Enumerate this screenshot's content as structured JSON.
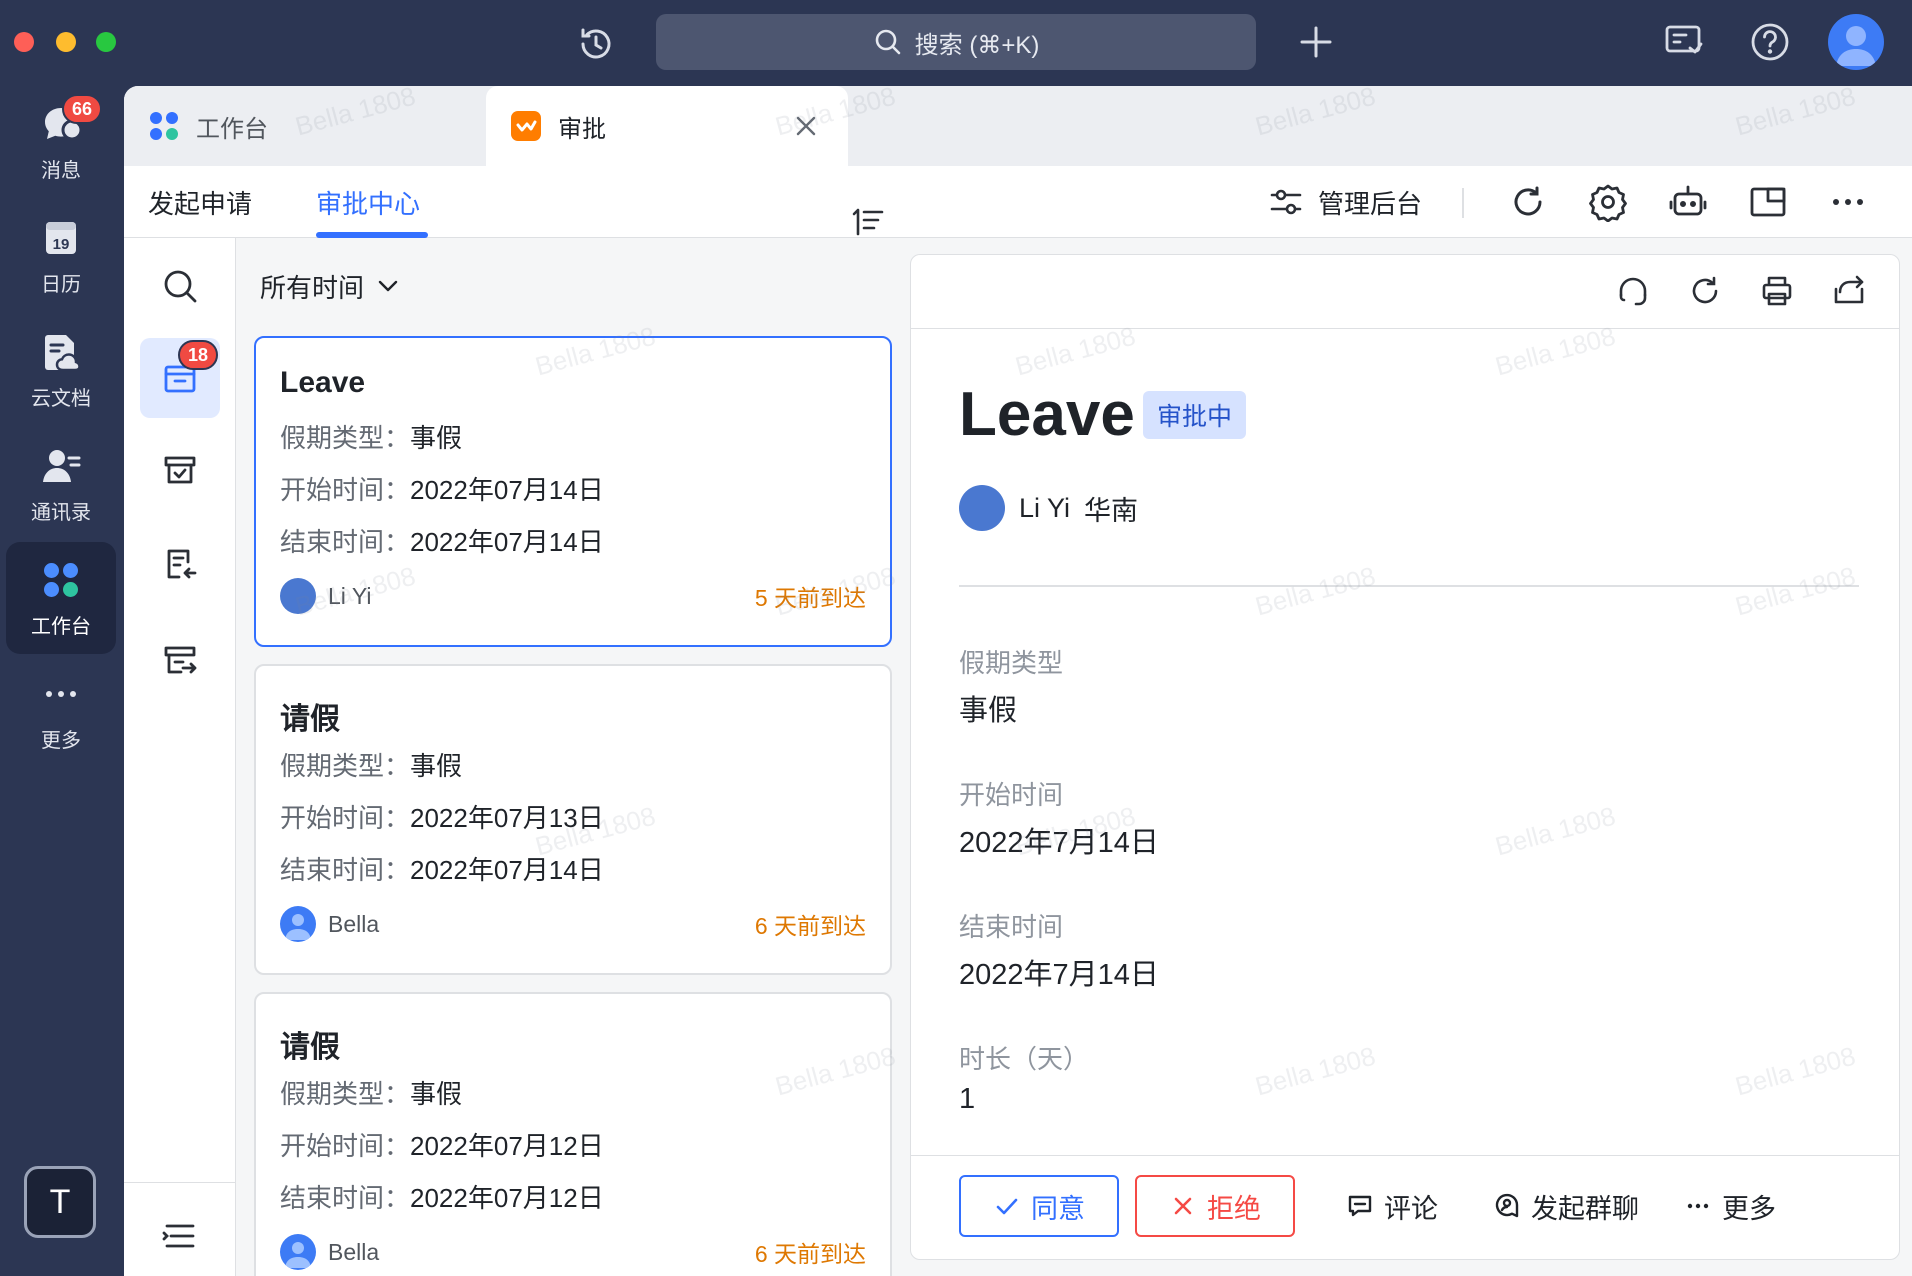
{
  "titlebar": {
    "search_label": "搜索 (⌘+K)"
  },
  "sidebar": {
    "items": [
      {
        "label": "消息",
        "badge": "66"
      },
      {
        "label": "日历",
        "date": "19"
      },
      {
        "label": "云文档"
      },
      {
        "label": "通讯录"
      },
      {
        "label": "工作台"
      },
      {
        "label": "更多"
      }
    ],
    "user_initial": "T"
  },
  "tabs": [
    {
      "label": "工作台"
    },
    {
      "label": "审批"
    }
  ],
  "subnav": {
    "tabs": [
      {
        "label": "发起申请"
      },
      {
        "label": "审批中心"
      }
    ],
    "admin_label": "管理后台"
  },
  "rail": {
    "pending_badge": "18"
  },
  "list": {
    "filter_label": "所有时间",
    "cards": [
      {
        "title": "Leave",
        "rows": [
          {
            "label": "假期类型：",
            "value": "事假"
          },
          {
            "label": "开始时间：",
            "value": "2022年07月14日"
          },
          {
            "label": "结束时间：",
            "value": "2022年07月14日"
          }
        ],
        "user": "Li Yi",
        "arrived": "5 天前到达"
      },
      {
        "title": "请假",
        "rows": [
          {
            "label": "假期类型：",
            "value": "事假"
          },
          {
            "label": "开始时间：",
            "value": "2022年07月13日"
          },
          {
            "label": "结束时间：",
            "value": "2022年07月14日"
          }
        ],
        "user": "Bella",
        "arrived": "6 天前到达"
      },
      {
        "title": "请假",
        "rows": [
          {
            "label": "假期类型：",
            "value": "事假"
          },
          {
            "label": "开始时间：",
            "value": "2022年07月12日"
          },
          {
            "label": "结束时间：",
            "value": "2022年07月12日"
          }
        ],
        "user": "Bella",
        "arrived": "6 天前到达"
      }
    ]
  },
  "detail": {
    "title": "Leave",
    "status": "审批中",
    "user_name": "Li Yi",
    "user_region": "华南",
    "fields": [
      {
        "label": "假期类型",
        "value": "事假"
      },
      {
        "label": "开始时间",
        "value": "2022年7月14日"
      },
      {
        "label": "结束时间",
        "value": "2022年7月14日"
      },
      {
        "label": "时长（天）",
        "value": "1"
      }
    ],
    "actions": {
      "approve": "同意",
      "reject": "拒绝",
      "comment": "评论",
      "group_chat": "发起群聊",
      "more": "更多"
    }
  },
  "watermark": "Bella 1808",
  "colors": {
    "accent": "#3370ff",
    "danger": "#f54a45",
    "warning": "#de7802",
    "sidebar_bg": "#2c3653"
  }
}
